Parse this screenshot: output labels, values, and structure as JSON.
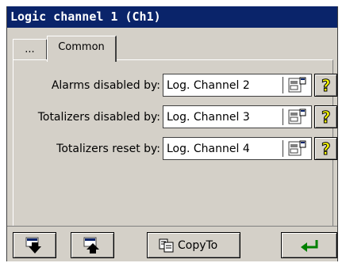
{
  "window": {
    "title": "Logic channel 1 (Ch1)"
  },
  "tabs": [
    {
      "label": "..."
    },
    {
      "label": "Common"
    }
  ],
  "rows": [
    {
      "label": "Alarms disabled by:",
      "value": "Log. Channel 2"
    },
    {
      "label": "Totalizers disabled by:",
      "value": "Log. Channel 3"
    },
    {
      "label": "Totalizers reset by:",
      "value": "Log. Channel 4"
    }
  ],
  "help_glyph": "?",
  "bottom": {
    "copy_label": "CopyTo"
  },
  "icons": {
    "row_picker": "select-dialog-icon",
    "help": "question-mark-icon",
    "next": "scroll-down-icon",
    "prev": "scroll-up-icon",
    "copy": "copy-icon",
    "enter": "enter-arrow-icon"
  },
  "colors": {
    "titlebar": "#0a246a",
    "window_bg": "#d4d0c8",
    "help_icon": "#ffff00",
    "enter_arrow": "#008000"
  }
}
